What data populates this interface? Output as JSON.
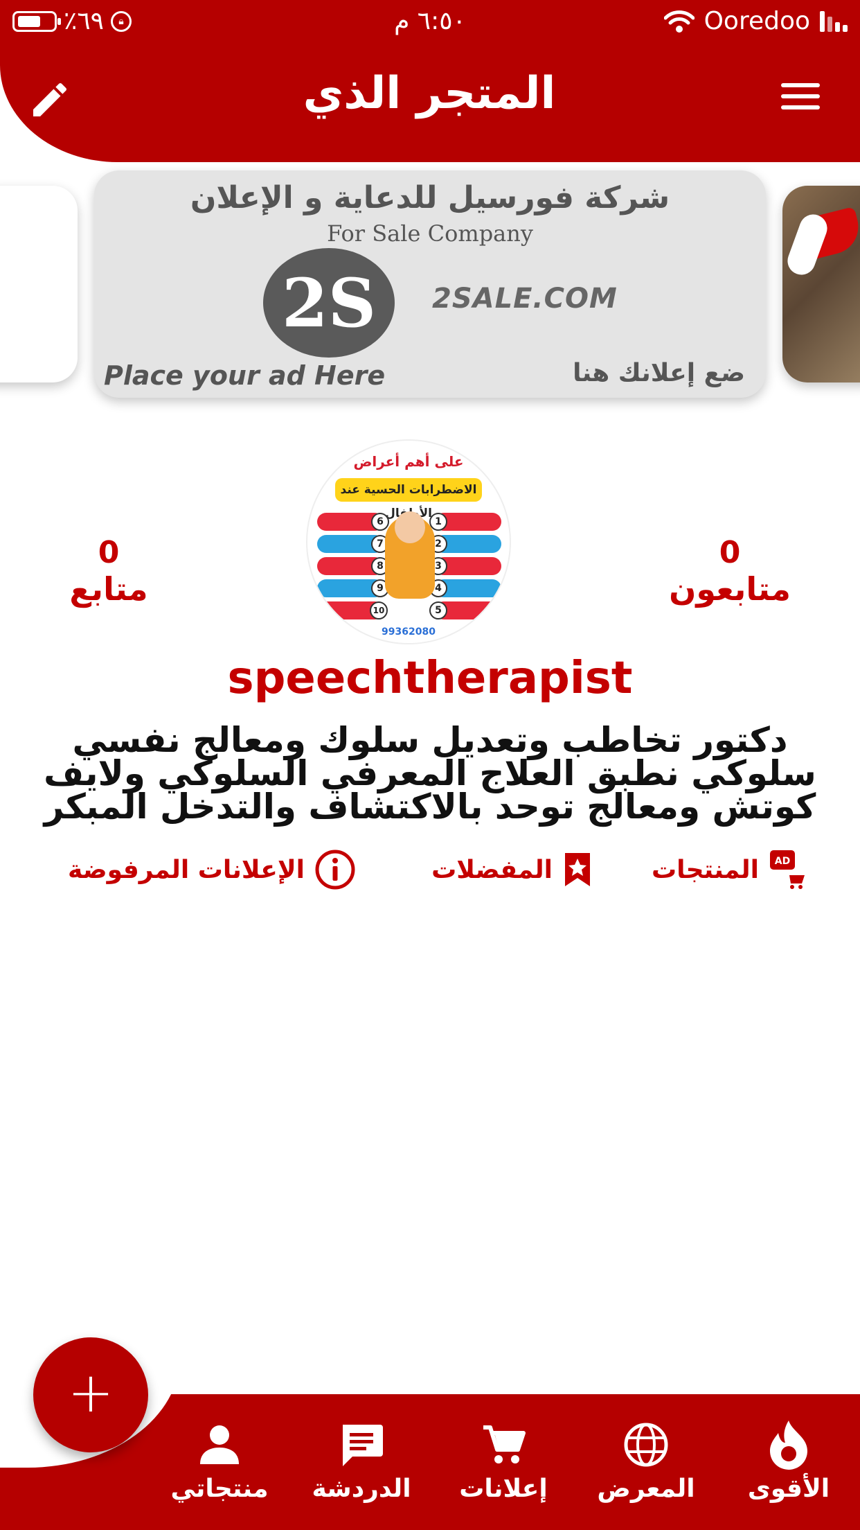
{
  "status_bar": {
    "battery": "٪٦٩",
    "time": "٦:٥٠ م",
    "carrier": "Ooredoo"
  },
  "header": {
    "title": "المتجر الذي"
  },
  "ad_banner": {
    "title_ar": "شركة فورسيل للدعاية و الإعلان",
    "title_en": "For Sale Company",
    "logo_text": "2S",
    "domain": "2SALE.COM",
    "place_en": "Place your ad Here",
    "place_ar": "ضع إعلانك هنا"
  },
  "profile": {
    "avatar": {
      "heading": "على أهم أعراض",
      "banner": "الاضطرابات الحسية عند الأطفال",
      "phone": "99362080"
    },
    "followers_count": "0",
    "followers_label": "متابعون",
    "following_count": "0",
    "following_label": "متابع",
    "username": "speechtherapist",
    "bio": "دكتور تخاطب وتعديل سلوك ومعالج نفسي سلوكي نطبق العلاج المعرفي السلوكي ولايف كوتش ومعالج توحد بالاكتشاف والتدخل المبكر"
  },
  "tabs": [
    {
      "label": "المنتجات",
      "icon": "ad-cart-icon"
    },
    {
      "label": "المفضلات",
      "icon": "bookmark-star-icon"
    },
    {
      "label": "الإعلانات المرفوضة",
      "icon": "info-icon"
    }
  ],
  "bottom_nav": [
    {
      "label": "الأقوى",
      "icon": "flame-icon"
    },
    {
      "label": "المعرض",
      "icon": "globe-icon"
    },
    {
      "label": "إعلانات",
      "icon": "cart-icon"
    },
    {
      "label": "الدردشة",
      "icon": "chat-icon"
    },
    {
      "label": "منتجاتي",
      "icon": "person-icon"
    }
  ],
  "fab": {
    "label": "+"
  },
  "colors": {
    "primary": "#b50000",
    "accent_text": "#c40000",
    "background": "#ffffff"
  }
}
